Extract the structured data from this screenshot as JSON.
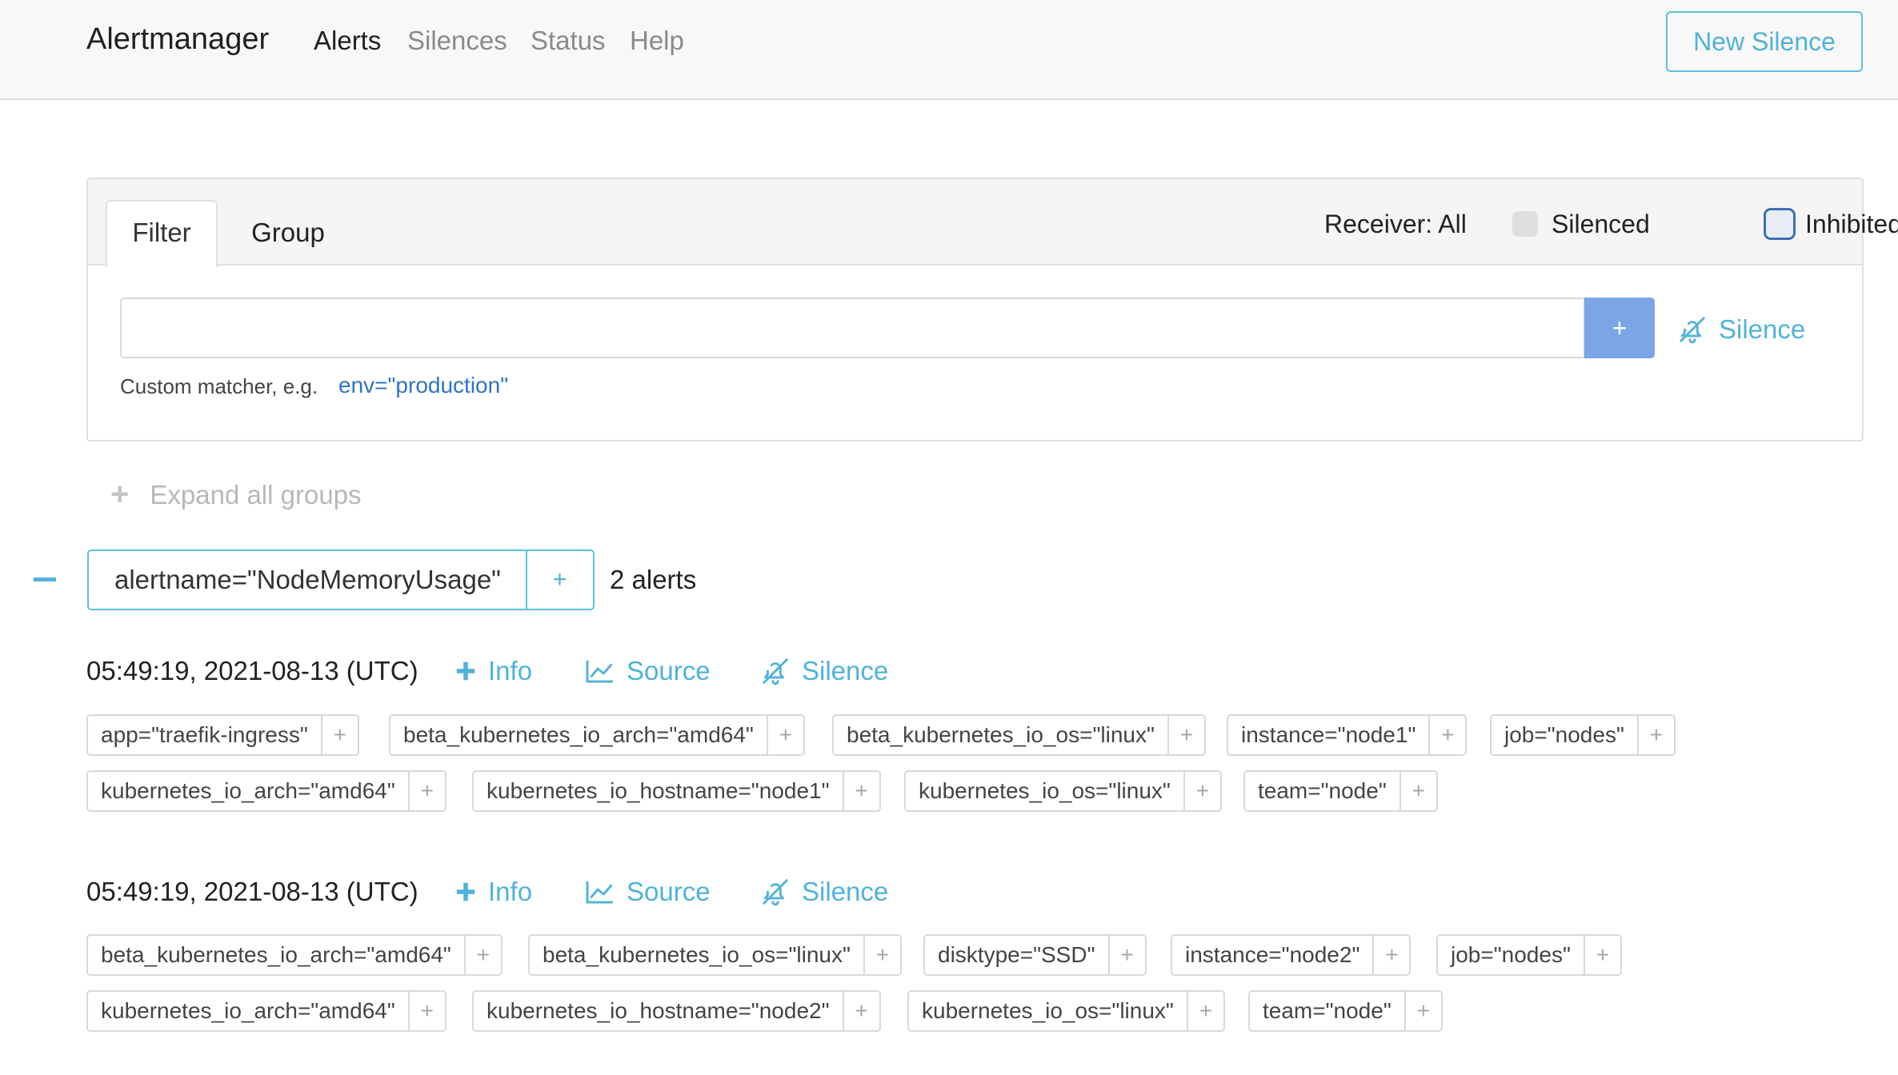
{
  "navbar": {
    "brand": "Alertmanager",
    "links": [
      "Alerts",
      "Silences",
      "Status",
      "Help"
    ],
    "new_silence": "New Silence"
  },
  "filter_card": {
    "tabs": [
      "Filter",
      "Group"
    ],
    "receiver": "Receiver: All",
    "silenced_label": "Silenced",
    "inhibited_label": "Inhibited",
    "input_value": "",
    "add_label": "+",
    "silence_label": "Silence",
    "hint_text": "Custom matcher, e.g.",
    "hint_example": "env=\"production\""
  },
  "expand_all": "Expand all groups",
  "group": {
    "label": "alertname=\"NodeMemoryUsage\"",
    "add": "+",
    "count": "2 alerts",
    "alerts": [
      {
        "timestamp": "05:49:19, 2021-08-13 (UTC)",
        "info": "Info",
        "source": "Source",
        "silence": "Silence",
        "labels": [
          "app=\"traefik-ingress\"",
          "beta_kubernetes_io_arch=\"amd64\"",
          "beta_kubernetes_io_os=\"linux\"",
          "instance=\"node1\"",
          "job=\"nodes\"",
          "kubernetes_io_arch=\"amd64\"",
          "kubernetes_io_hostname=\"node1\"",
          "kubernetes_io_os=\"linux\"",
          "team=\"node\""
        ]
      },
      {
        "timestamp": "05:49:19, 2021-08-13 (UTC)",
        "info": "Info",
        "source": "Source",
        "silence": "Silence",
        "labels": [
          "beta_kubernetes_io_arch=\"amd64\"",
          "beta_kubernetes_io_os=\"linux\"",
          "disktype=\"SSD\"",
          "instance=\"node2\"",
          "job=\"nodes\"",
          "kubernetes_io_arch=\"amd64\"",
          "kubernetes_io_hostname=\"node2\"",
          "kubernetes_io_os=\"linux\"",
          "team=\"node\""
        ]
      }
    ]
  },
  "colors": {
    "accent": "#4fb3d9",
    "primary_button": "#7ba6e6",
    "link": "#2f74c4"
  },
  "icons": [
    "plus-icon",
    "chart-line-icon",
    "bell-slash-icon",
    "minus-icon"
  ]
}
